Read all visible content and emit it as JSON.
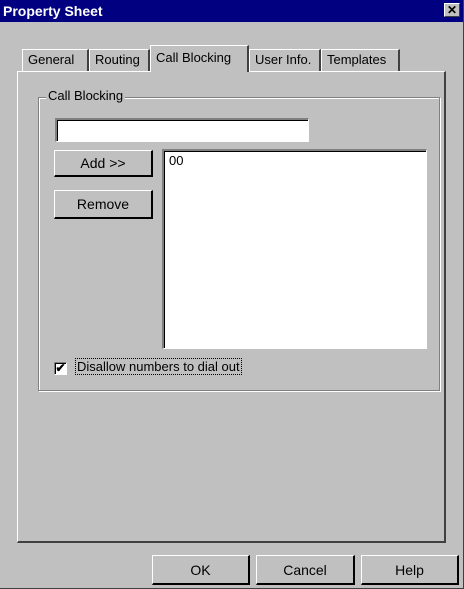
{
  "window": {
    "title": "Property Sheet",
    "close_glyph": "✕"
  },
  "tabs": [
    {
      "label": "General"
    },
    {
      "label": "Routing"
    },
    {
      "label": "Call Blocking",
      "active": true
    },
    {
      "label": "User Info."
    },
    {
      "label": "Templates"
    }
  ],
  "call_blocking": {
    "group_label": "Call Blocking",
    "number_input": {
      "value": ""
    },
    "add_label": "Add >>",
    "remove_label": "Remove",
    "blocked_list": [
      "00"
    ],
    "disallow_checkbox": {
      "label": "Disallow numbers to dial out",
      "checked": true,
      "mark": "✔"
    }
  },
  "buttons": {
    "ok": "OK",
    "cancel": "Cancel",
    "help": "Help"
  }
}
